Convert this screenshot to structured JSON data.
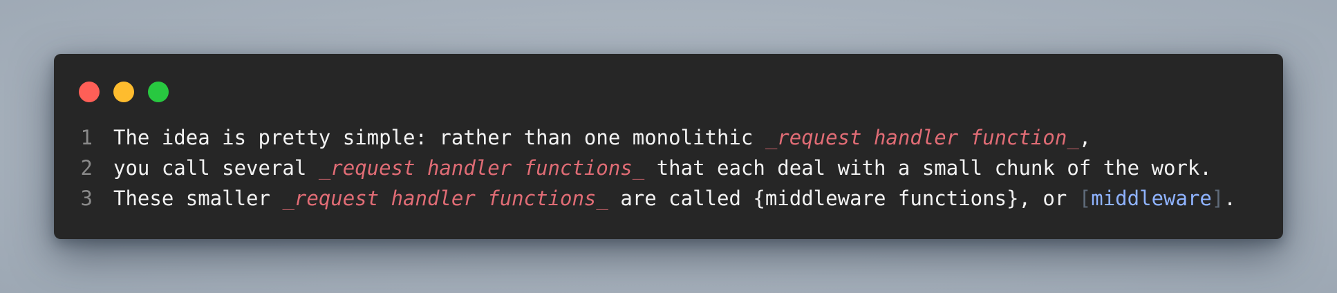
{
  "window": {
    "controls": [
      {
        "name": "close",
        "color": "#ff5f57"
      },
      {
        "name": "minimize",
        "color": "#febc2e"
      },
      {
        "name": "zoom",
        "color": "#28c840"
      }
    ]
  },
  "code": {
    "lines": [
      {
        "number": "1",
        "t1": "The idea is pretty simple: rather than one monolithic ",
        "em_open": "_",
        "em_text": "request handler function",
        "em_close": "_",
        "t2": ","
      },
      {
        "number": "2",
        "t1": "you call several ",
        "em_open": "_",
        "em_text": "request handler functions",
        "em_close": "_",
        "t2": " that each deal with a small chunk of the work."
      },
      {
        "number": "3",
        "t1": "These smaller ",
        "em_open": "_",
        "em_text": "request handler functions",
        "em_close": "_",
        "t2": " are called {middleware functions}, or ",
        "bracket_open": "[",
        "link_text": "middleware",
        "bracket_close": "]",
        "t3": "."
      }
    ]
  }
}
